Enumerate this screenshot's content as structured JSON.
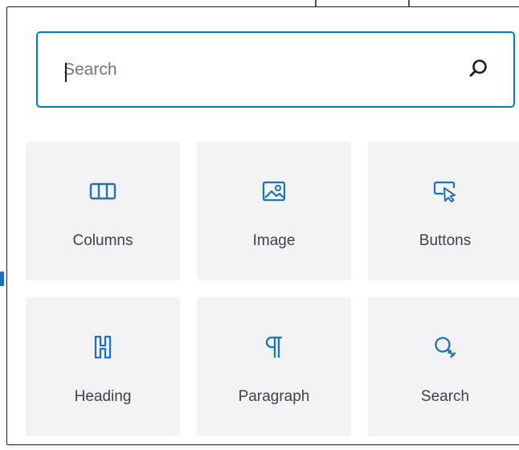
{
  "search": {
    "placeholder": "Search",
    "value": ""
  },
  "blocks": [
    {
      "label": "Columns",
      "icon": "columns-icon"
    },
    {
      "label": "Image",
      "icon": "image-icon"
    },
    {
      "label": "Buttons",
      "icon": "buttons-icon"
    },
    {
      "label": "Heading",
      "icon": "heading-icon"
    },
    {
      "label": "Paragraph",
      "icon": "paragraph-icon"
    },
    {
      "label": "Search",
      "icon": "search-block-icon"
    }
  ],
  "colors": {
    "accent": "#007cba",
    "tile_bg": "#f3f3f5",
    "icon": "#2271b1",
    "label": "#3c434a"
  }
}
